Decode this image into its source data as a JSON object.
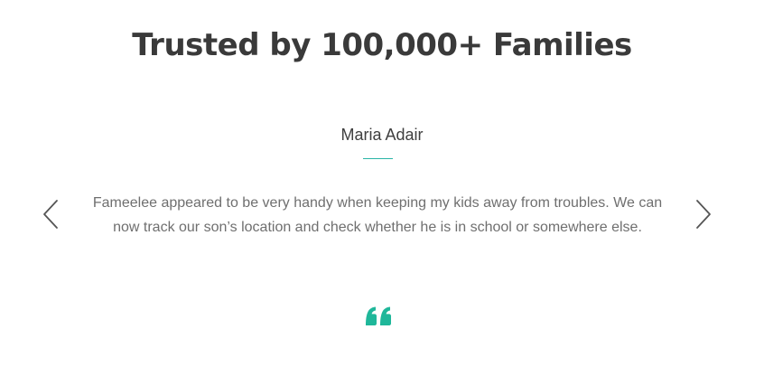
{
  "section": {
    "title": "Trusted by 100,000+ Families"
  },
  "testimonial": {
    "name": "Maria Adair",
    "text": "Fameelee appeared to be very handy when keeping my kids away from troubles. We can now track our son’s location and check whether he is in school or somewhere else."
  },
  "icons": {
    "previous": "chevron-left-icon",
    "next": "chevron-right-icon",
    "quote": "quote-icon"
  },
  "colors": {
    "accent": "#2bb5a7",
    "title": "#3a3a3a",
    "body_text": "#6f6f6f",
    "arrow": "#555555"
  }
}
